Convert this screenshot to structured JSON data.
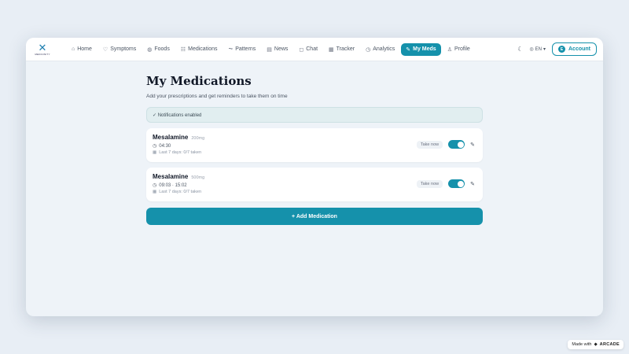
{
  "nav": {
    "logo_text": "MEDICINITY",
    "items": [
      {
        "label": "Home",
        "icon": "home-icon",
        "glyph": "⌂"
      },
      {
        "label": "Symptoms",
        "icon": "heart-icon",
        "glyph": "♡"
      },
      {
        "label": "Foods",
        "icon": "apple-icon",
        "glyph": "◍"
      },
      {
        "label": "Medications",
        "icon": "pill-list-icon",
        "glyph": "☷"
      },
      {
        "label": "Patterns",
        "icon": "pattern-icon",
        "glyph": "⏦"
      },
      {
        "label": "News",
        "icon": "newspaper-icon",
        "glyph": "▤"
      },
      {
        "label": "Chat",
        "icon": "chat-icon",
        "glyph": "◻"
      },
      {
        "label": "Tracker",
        "icon": "calendar-icon",
        "glyph": "▦"
      },
      {
        "label": "Analytics",
        "icon": "clock-icon",
        "glyph": "◷"
      },
      {
        "label": "My Meds",
        "icon": "pill-icon",
        "glyph": "✎"
      },
      {
        "label": "Profile",
        "icon": "user-icon",
        "glyph": "♙"
      }
    ],
    "active": "My Meds",
    "lang": "EN",
    "account_label": "Account",
    "account_initial": "E"
  },
  "page": {
    "title": "My Medications",
    "subtitle": "Add your prescriptions and get reminders to take them on time",
    "notice": "✓ Notifications enabled",
    "add_button": "+ Add Medication"
  },
  "medications": [
    {
      "name": "Mesalamine",
      "dose": "200mg",
      "times": "04:30",
      "history": "Last 7 days: 0/7 taken",
      "take_now": "Take now",
      "enabled": true
    },
    {
      "name": "Mesalamine",
      "dose": "500mg",
      "times": "09:03 · 15:02",
      "history": "Last 7 days: 0/7 taken",
      "take_now": "Take now",
      "enabled": true
    }
  ],
  "badge": {
    "prefix": "Made with",
    "brand": "ARCADE"
  },
  "colors": {
    "accent": "#1591ab",
    "background": "#e8eef5"
  }
}
